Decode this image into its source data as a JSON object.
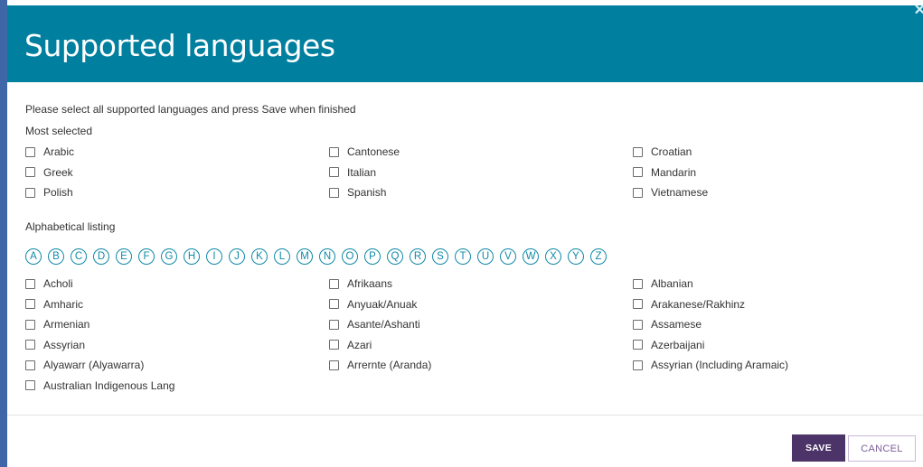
{
  "header": {
    "title": "Supported languages",
    "close": "×"
  },
  "intro": "Please select all supported languages and press Save when finished",
  "most_selected": {
    "label": "Most selected",
    "items": [
      "Arabic",
      "Cantonese",
      "Croatian",
      "Greek",
      "Italian",
      "Mandarin",
      "Polish",
      "Spanish",
      "Vietnamese"
    ]
  },
  "alphabetical": {
    "label": "Alphabetical listing",
    "letters": [
      "A",
      "B",
      "C",
      "D",
      "E",
      "F",
      "G",
      "H",
      "I",
      "J",
      "K",
      "L",
      "M",
      "N",
      "O",
      "P",
      "Q",
      "R",
      "S",
      "T",
      "U",
      "V",
      "W",
      "X",
      "Y",
      "Z"
    ],
    "items": [
      "Acholi",
      "Afrikaans",
      "Albanian",
      "Amharic",
      "Anyuak/Anuak",
      "Arakanese/Rakhinz",
      "Armenian",
      "Asante/Ashanti",
      "Assamese",
      "Assyrian",
      "Azari",
      "Azerbaijani",
      "Alyawarr (Alyawarra)",
      "Arrernte (Aranda)",
      "Assyrian (Including Aramaic)",
      "Australian Indigenous Lang"
    ]
  },
  "footer": {
    "save_label": "SAVE",
    "cancel_label": "CANCEL"
  },
  "colors": {
    "header_bg": "#007f9f",
    "accent": "#0f8aa8",
    "save_bg": "#4d3468",
    "cancel_text": "#7d5f99"
  }
}
